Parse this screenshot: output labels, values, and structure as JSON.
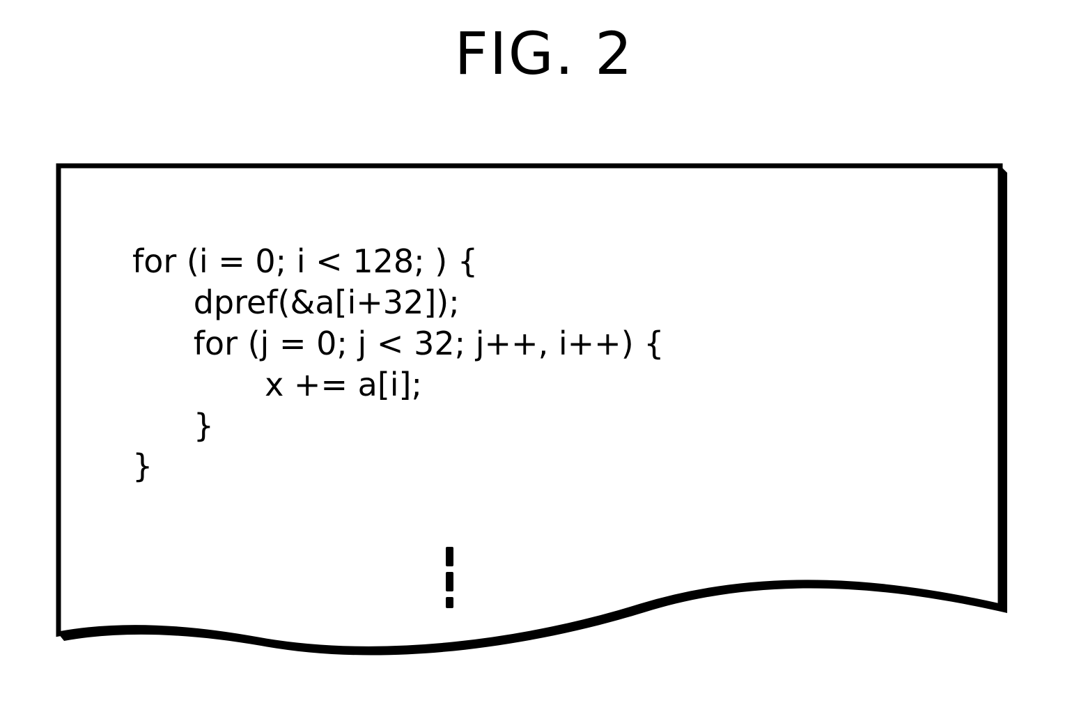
{
  "title": "FIG. 2",
  "code": {
    "l1": "for (i = 0; i < 128; ) {",
    "l2": "      dpref(&a[i+32]);",
    "l3": "      for (j = 0; j < 32; j++, i++) {",
    "l4": "             x += a[i];",
    "l5": "      }",
    "l6": "}"
  }
}
